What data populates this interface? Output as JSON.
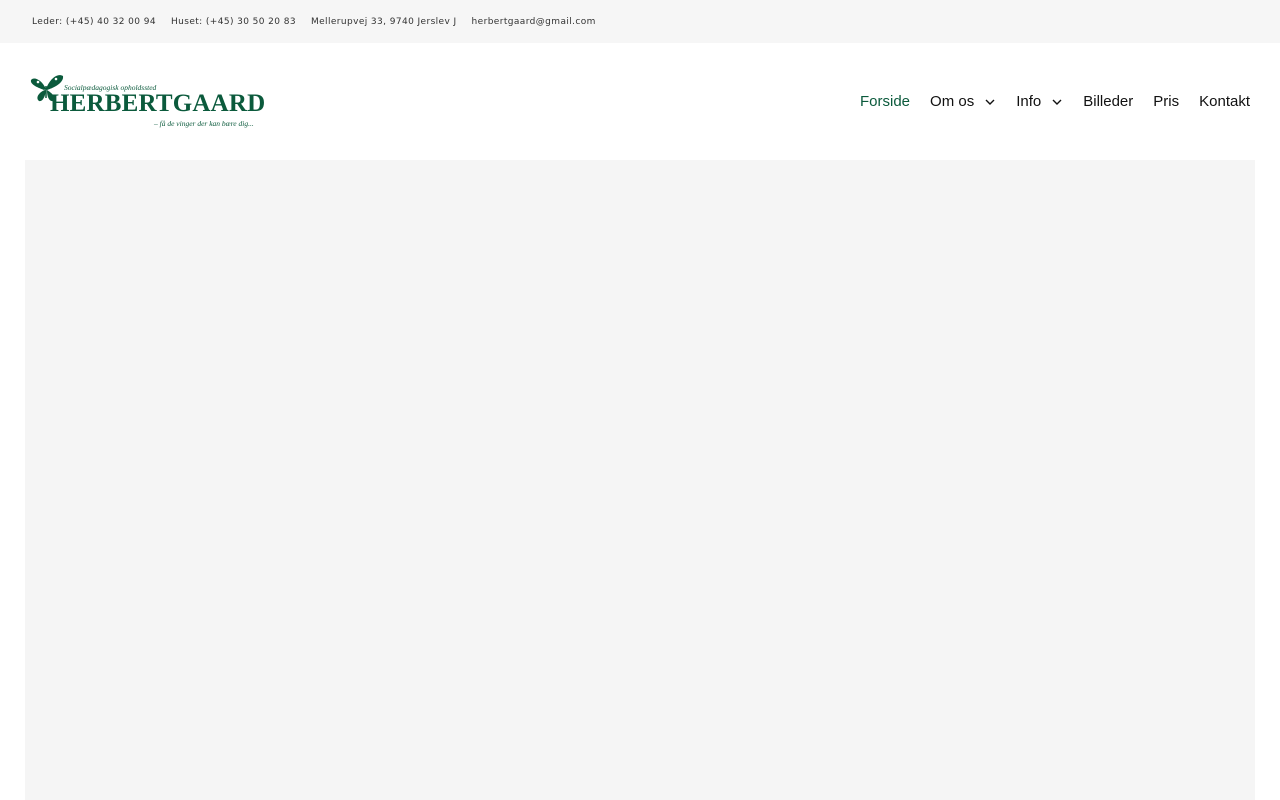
{
  "topbar": {
    "leader_phone": "Leder: (+45) 40 32 00 94",
    "house_phone": "Huset: (+45) 30 50 20 83",
    "address": "Mellerupvej 33, 9740 Jerslev J",
    "email": "herbertgaard@gmail.com"
  },
  "logo": {
    "tagline_top": "Socialpædagogisk opholdssted",
    "name": "HERBERTGAARD",
    "tagline_bottom": "– få de vinger der kan bære dig...",
    "icon": "butterfly-icon",
    "color": "#0b5a3c"
  },
  "nav": {
    "items": [
      {
        "label": "Forside",
        "active": true
      },
      {
        "label": "Om os",
        "dropdown": true
      },
      {
        "label": "Info",
        "dropdown": true
      },
      {
        "label": "Billeder"
      },
      {
        "label": "Pris"
      },
      {
        "label": "Kontakt"
      }
    ],
    "active_color": "#0b5a3c"
  },
  "colors": {
    "topbar_bg": "#f6f6f6",
    "hero_bg": "#f5f5f5",
    "text": "#111111"
  }
}
